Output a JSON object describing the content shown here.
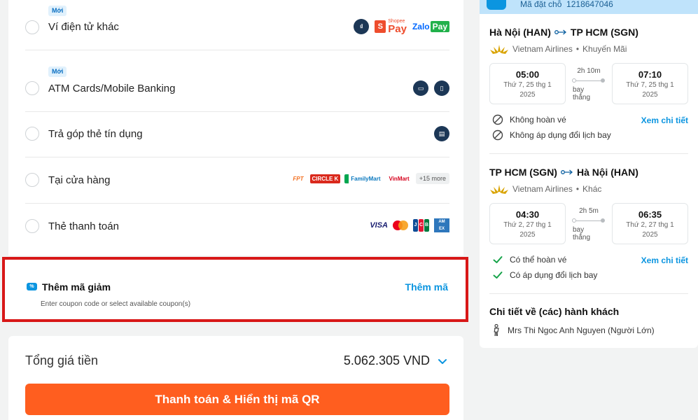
{
  "payment_methods": [
    {
      "label": "Ví điện tử khác",
      "badge": "Mới",
      "logos": [
        "payment-wallet-icon",
        "shopee-pay-logo",
        "zalo-pay-logo"
      ]
    },
    {
      "label": "ATM Cards/Mobile Banking",
      "badge": "Mới",
      "logos": [
        "bank-card-icon",
        "mobile-banking-icon"
      ]
    },
    {
      "label": "Trả góp thẻ tín dụng",
      "logos": [
        "installment-card-icon"
      ]
    },
    {
      "label": "Tại cửa hàng",
      "logos": [
        "fpt-logo",
        "circle-k-logo",
        "familymart-logo",
        "vinmart-logo"
      ],
      "more": "+15 more"
    },
    {
      "label": "Thẻ thanh toán",
      "logos": [
        "visa-logo",
        "mastercard-logo",
        "jcb-logo",
        "amex-logo"
      ]
    }
  ],
  "brand_text": {
    "shopee_small": "Shopee",
    "shopee_pay": "Pay",
    "zalo": "Zalo",
    "zalo_pay": "Pay",
    "fpt": "FPT",
    "circle_k": "CIRCLE K",
    "familymart": "FamilyMart",
    "vinmart": "VinMart",
    "visa": "VISA",
    "jcb": [
      "J",
      "C",
      "B"
    ],
    "amex": [
      "AM",
      "EX"
    ]
  },
  "coupon": {
    "title": "Thêm mã giảm",
    "link": "Thêm mã",
    "subtitle": "Enter coupon code or select available coupon(s)"
  },
  "total": {
    "label": "Tổng giá tiền",
    "amount": "5.062.305 VND",
    "button": "Thanh toán & Hiển thị mã QR"
  },
  "booking": {
    "code_label": "Mã đặt chỗ",
    "code": "1218647046"
  },
  "flights": [
    {
      "from": "Hà Nội (HAN)",
      "to": "TP HCM (SGN)",
      "airline": "Vietnam Airlines",
      "fare": "Khuyến Mãi",
      "dep_time": "05:00",
      "dep_date": "Thứ 7, 25 thg 1",
      "dep_year": "2025",
      "duration": "2h 10m",
      "stop_type": "bay",
      "stop_type2": "thẳng",
      "arr_time": "07:10",
      "arr_date": "Thứ 7, 25 thg 1",
      "arr_year": "2025",
      "policy_refund": "Không hoàn vé",
      "policy_reschedule": "Không áp dụng đổi lịch bay",
      "detail_link": "Xem chi tiết"
    },
    {
      "from": "TP HCM (SGN)",
      "to": "Hà Nội (HAN)",
      "airline": "Vietnam Airlines",
      "fare": "Khác",
      "dep_time": "04:30",
      "dep_date": "Thứ 2, 27 thg 1",
      "dep_year": "2025",
      "duration": "2h 5m",
      "stop_type": "bay",
      "stop_type2": "thẳng",
      "arr_time": "06:35",
      "arr_date": "Thứ 2, 27 thg 1",
      "arr_year": "2025",
      "policy_refund": "Có thể hoàn vé",
      "policy_reschedule": "Có áp dụng đổi lịch bay",
      "detail_link": "Xem chi tiết"
    }
  ],
  "passengers": {
    "title": "Chi tiết về (các) hành khách",
    "list": [
      "Mrs Thi Ngoc Anh Nguyen (Người Lớn)"
    ]
  },
  "colors": {
    "accent": "#0b95e0",
    "pay_button": "#ff5e1f",
    "highlight_border": "#d81818",
    "allowed_check": "#16a34a"
  }
}
